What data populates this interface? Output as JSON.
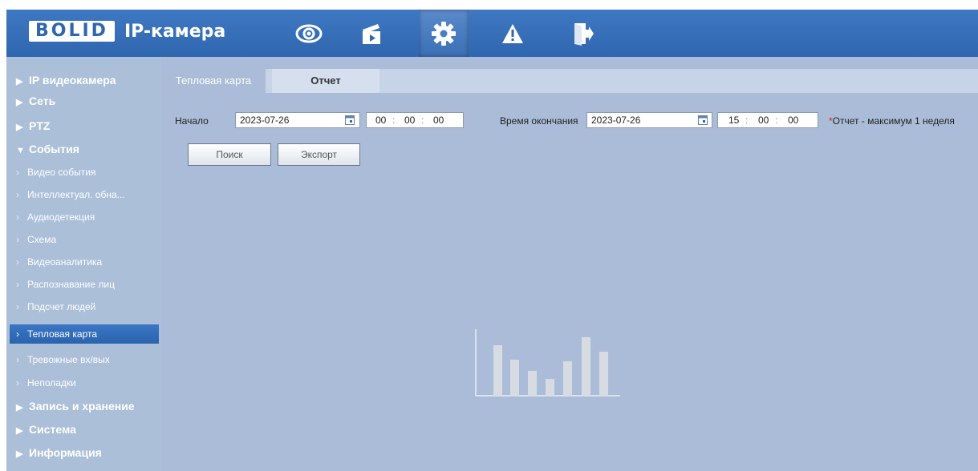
{
  "header": {
    "brand": "BOLID",
    "model": "IP-камера",
    "nav": [
      {
        "icon": "eye-icon",
        "label": "Просмотр"
      },
      {
        "icon": "clapperboard-icon",
        "label": "Воспроизведение"
      },
      {
        "icon": "gear-icon",
        "label": "Настройки",
        "active": true
      },
      {
        "icon": "warning-icon",
        "label": "Тревога"
      },
      {
        "icon": "logout-icon",
        "label": "Выход"
      }
    ]
  },
  "sidebar": {
    "items": [
      {
        "label": "IP видеокамера",
        "level": 0
      },
      {
        "label": "Сеть",
        "level": 0
      },
      {
        "label": "PTZ",
        "level": 0
      },
      {
        "label": "События",
        "level": 0,
        "expanded": true
      },
      {
        "label": "Видео события",
        "level": 1
      },
      {
        "label": "Интеллектуал. обна...",
        "level": 1
      },
      {
        "label": "Аудиодетекция",
        "level": 1
      },
      {
        "label": "Схема",
        "level": 1
      },
      {
        "label": "Видеоаналитика",
        "level": 1
      },
      {
        "label": "Распознавание лиц",
        "level": 1
      },
      {
        "label": "Подсчет людей",
        "level": 1
      },
      {
        "label": "Тепловая карта",
        "level": 1,
        "selected": true
      },
      {
        "label": "Тревожные вх/вых",
        "level": 1
      },
      {
        "label": "Неполадки",
        "level": 1
      },
      {
        "label": "Запись и хранение",
        "level": 0
      },
      {
        "label": "Система",
        "level": 0
      },
      {
        "label": "Информация",
        "level": 0
      }
    ]
  },
  "tabs": [
    "Тепловая карта",
    "Отчет"
  ],
  "form": {
    "start_label": "Начало",
    "start_date": "2023-07-26",
    "start_time": {
      "h": "00",
      "m": "00",
      "s": "00"
    },
    "end_label": "Время окончания",
    "end_date": "2023-07-26",
    "end_time": {
      "h": "15",
      "m": "00",
      "s": "00"
    },
    "note_star": "*",
    "note": "Отчет - максимум 1 неделя",
    "search_button": "Поиск",
    "export_button": "Экспорт"
  },
  "colors": {
    "topbar": "#2f66b0",
    "sidebar": "#abbfd9",
    "content": "#aabcd7",
    "selected": "#2a63ae"
  }
}
